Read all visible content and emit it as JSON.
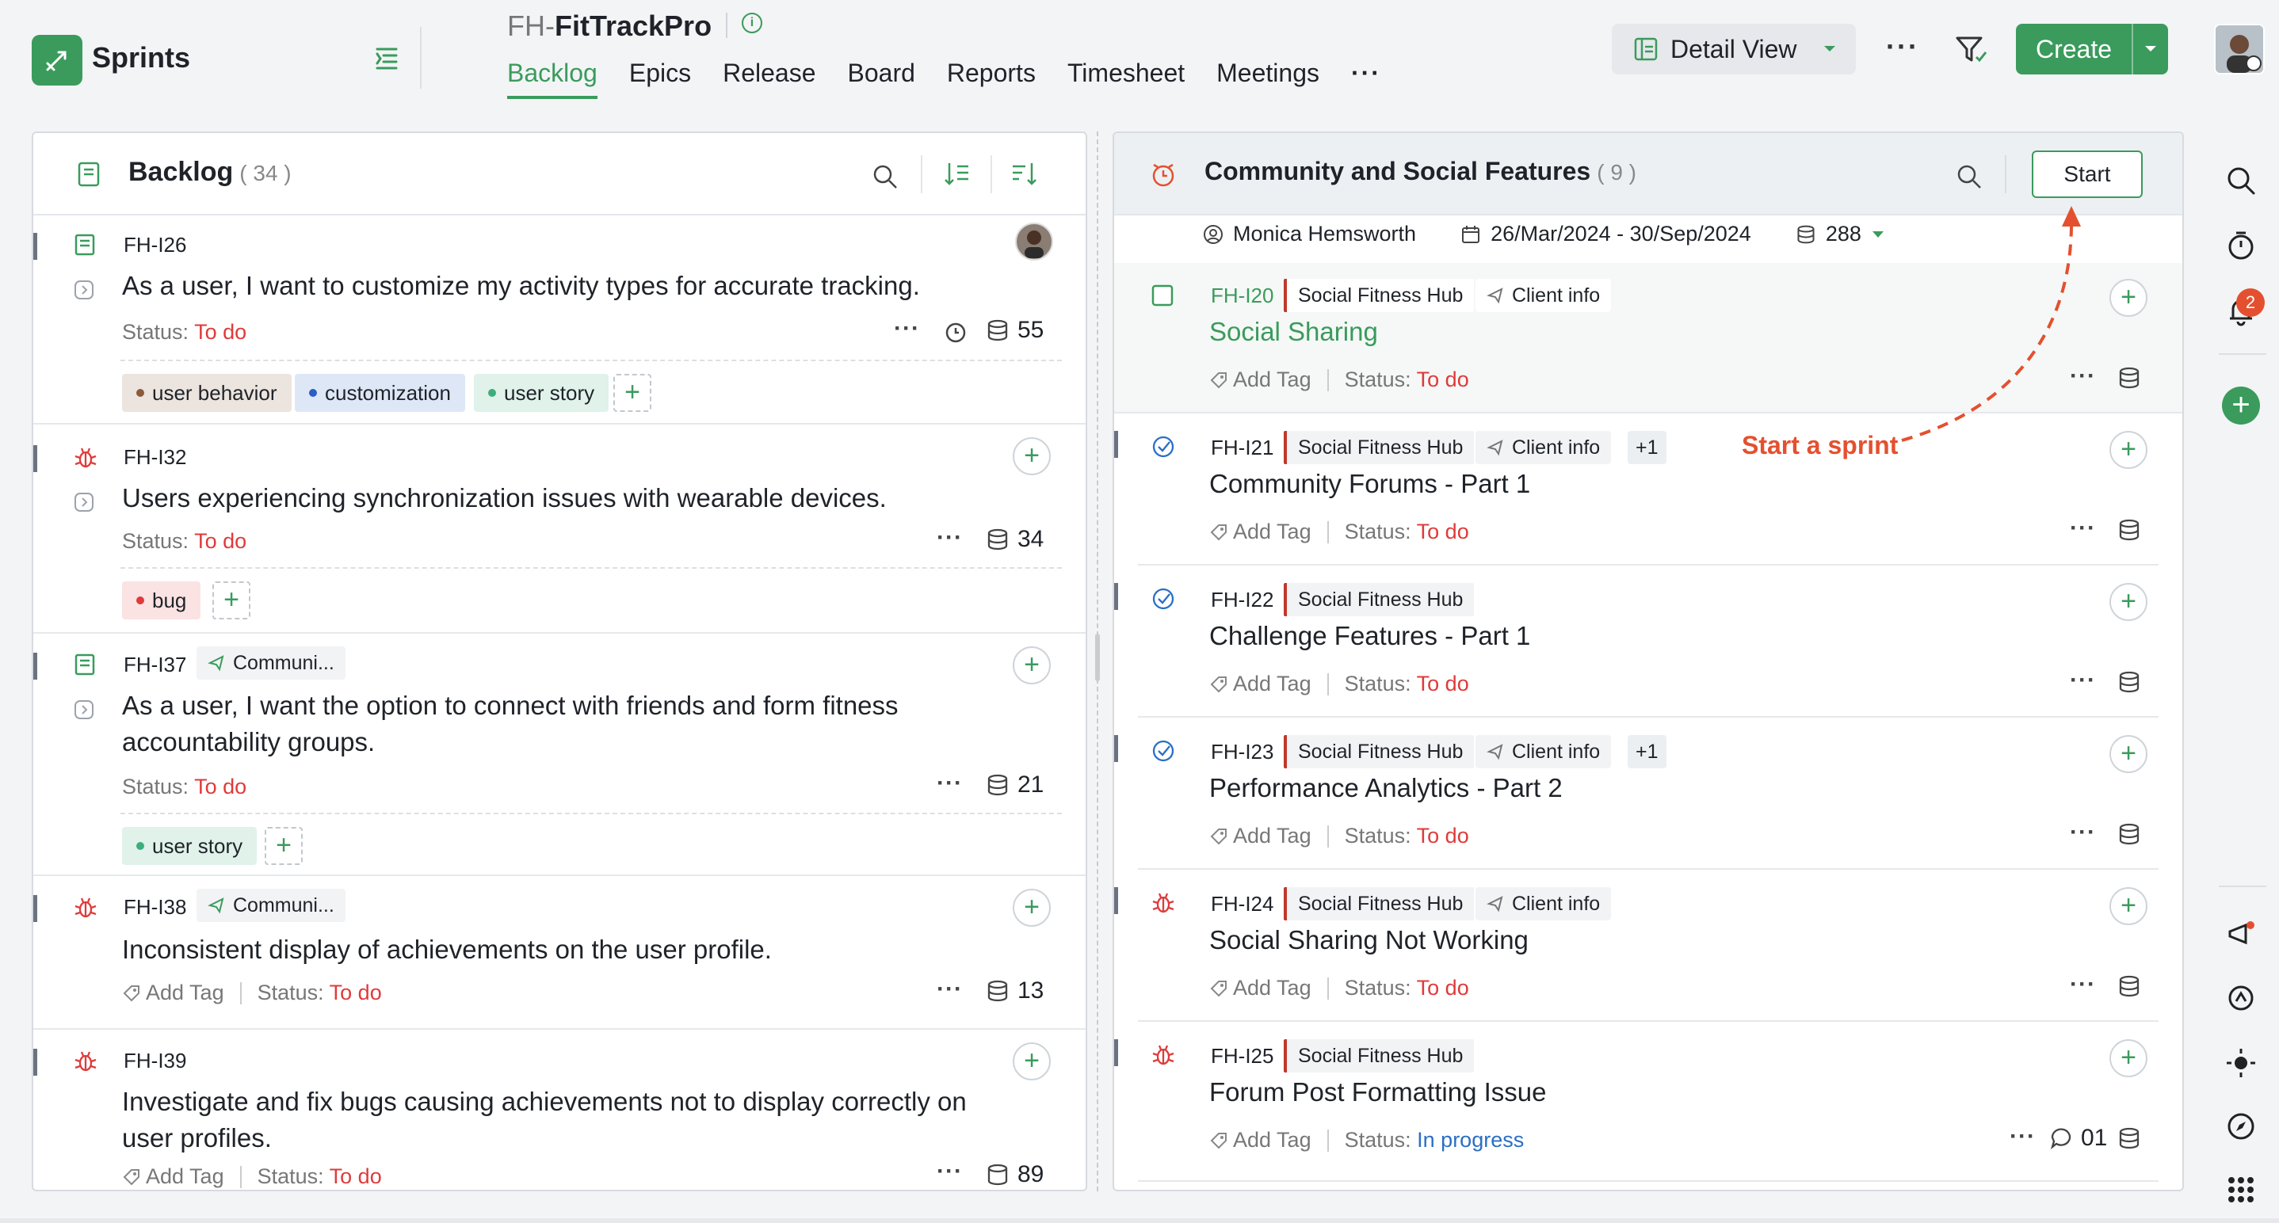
{
  "app": {
    "name": "Sprints"
  },
  "project": {
    "prefix": "FH-",
    "name": "FitTrackPro"
  },
  "tabs": [
    {
      "label": "Backlog",
      "active": true
    },
    {
      "label": "Epics"
    },
    {
      "label": "Release"
    },
    {
      "label": "Board"
    },
    {
      "label": "Reports"
    },
    {
      "label": "Timesheet"
    },
    {
      "label": "Meetings"
    }
  ],
  "toolbar": {
    "view_label": "Detail View",
    "create_label": "Create"
  },
  "colors": {
    "accent": "#3a9b5c",
    "todo": "#e03a3a",
    "in_progress": "#2a6fc4",
    "annotation": "#e4502f"
  },
  "notifications": {
    "count": "2"
  },
  "backlog": {
    "title": "Backlog",
    "count": "( 34 )",
    "items": [
      {
        "id": "FH-I26",
        "title": "As a user, I want to customize my activity types for accurate tracking.",
        "status_label": "Status:",
        "status": "To do",
        "points": "55",
        "tags": [
          {
            "label": "user behavior"
          },
          {
            "label": "customization"
          },
          {
            "label": "user story"
          }
        ]
      },
      {
        "id": "FH-I32",
        "title": "Users experiencing synchronization issues with wearable devices.",
        "status_label": "Status:",
        "status": "To do",
        "points": "34",
        "tags": [
          {
            "label": "bug"
          }
        ]
      },
      {
        "id": "FH-I37",
        "epic": "Communi...",
        "title": "As a user, I want the option to connect with friends and form fitness accountability groups.",
        "status_label": "Status:",
        "status": "To do",
        "points": "21",
        "tags": [
          {
            "label": "user story"
          }
        ]
      },
      {
        "id": "FH-I38",
        "epic": "Communi...",
        "title": "Inconsistent display of achievements on the user profile.",
        "add_tag": "Add Tag",
        "status_label": "Status:",
        "status": "To do",
        "points": "13"
      },
      {
        "id": "FH-I39",
        "title": "Investigate and fix bugs causing achievements not to display correctly on user profiles.",
        "add_tag": "Add Tag",
        "status_label": "Status:",
        "status": "To do",
        "points": "89"
      }
    ]
  },
  "sprint": {
    "title": "Community and Social Features",
    "count": "( 9 )",
    "start_label": "Start",
    "owner": "Monica Hemsworth",
    "dates": "26/Mar/2024 - 30/Sep/2024",
    "points": "288",
    "items": [
      {
        "id": "FH-I20",
        "project": "Social Fitness Hub",
        "epic": "Client info",
        "title": "Social Sharing",
        "add_tag": "Add Tag",
        "status_label": "Status:",
        "status": "To do"
      },
      {
        "id": "FH-I21",
        "project": "Social Fitness Hub",
        "epic": "Client info",
        "extra": "+1",
        "title": "Community Forums - Part 1",
        "add_tag": "Add Tag",
        "status_label": "Status:",
        "status": "To do"
      },
      {
        "id": "FH-I22",
        "project": "Social Fitness Hub",
        "title": "Challenge Features - Part 1",
        "add_tag": "Add Tag",
        "status_label": "Status:",
        "status": "To do"
      },
      {
        "id": "FH-I23",
        "project": "Social Fitness Hub",
        "epic": "Client info",
        "extra": "+1",
        "title": "Performance Analytics - Part 2",
        "add_tag": "Add Tag",
        "status_label": "Status:",
        "status": "To do"
      },
      {
        "id": "FH-I24",
        "project": "Social Fitness Hub",
        "epic": "Client info",
        "title": "Social Sharing Not Working",
        "add_tag": "Add Tag",
        "status_label": "Status:",
        "status": "To do"
      },
      {
        "id": "FH-I25",
        "project": "Social Fitness Hub",
        "title": "Forum Post Formatting Issue",
        "add_tag": "Add Tag",
        "status_label": "Status:",
        "status": "In progress",
        "comments": "01"
      }
    ]
  },
  "annotation": {
    "text": "Start a sprint"
  }
}
